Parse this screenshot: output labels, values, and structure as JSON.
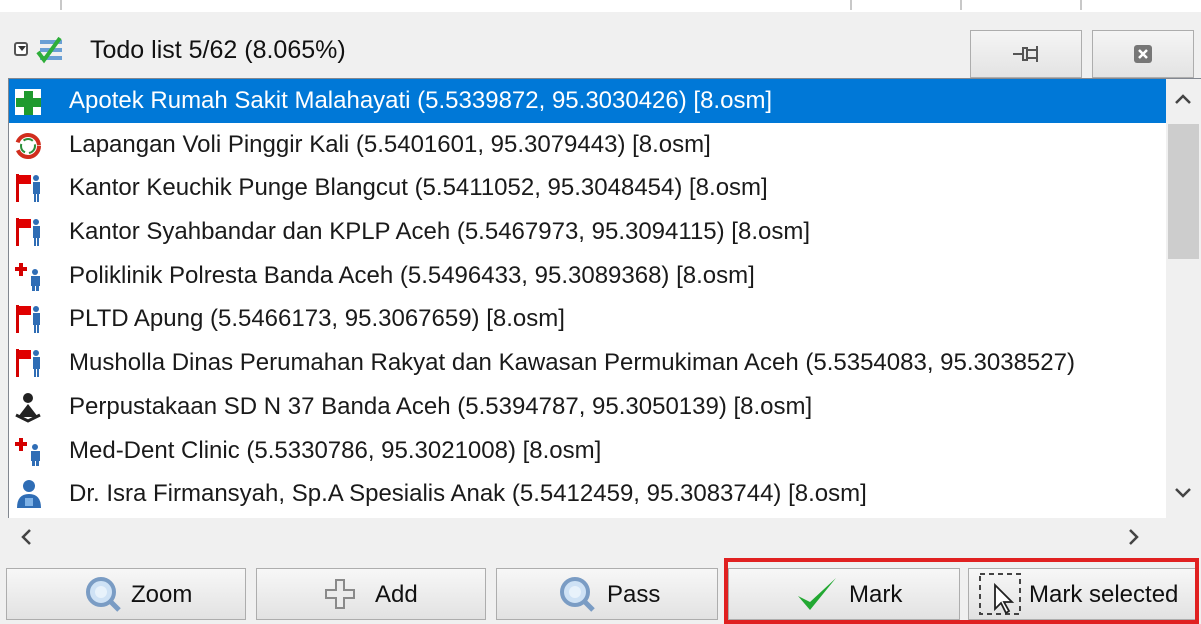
{
  "panel": {
    "title": "Todo list 5/62 (8.065%)",
    "icons": [
      "collapse-icon",
      "todo-list-icon",
      "pin-icon",
      "close-icon"
    ]
  },
  "items": [
    {
      "text": "Apotek Rumah Sakit Malahayati (5.5339872, 95.3030426) [8.osm]",
      "icon": "pharmacy-icon",
      "selected": true
    },
    {
      "text": "Lapangan Voli Pinggir Kali (5.5401601, 95.3079443) [8.osm]",
      "icon": "sports-pitch-icon",
      "selected": false
    },
    {
      "text": "Kantor Keuchik Punge Blangcut (5.5411052, 95.3048454) [8.osm]",
      "icon": "office-icon",
      "selected": false
    },
    {
      "text": "Kantor Syahbandar dan KPLP Aceh (5.5467973, 95.3094115) [8.osm]",
      "icon": "office-icon",
      "selected": false
    },
    {
      "text": "Poliklinik Polresta Banda Aceh (5.5496433, 95.3089368) [8.osm]",
      "icon": "clinic-icon",
      "selected": false
    },
    {
      "text": "PLTD Apung (5.5466173, 95.3067659) [8.osm]",
      "icon": "office-icon",
      "selected": false
    },
    {
      "text": "Musholla Dinas Perumahan Rakyat dan Kawasan Permukiman Aceh (5.5354083, 95.3038527)",
      "icon": "office-icon",
      "selected": false
    },
    {
      "text": "Perpustakaan SD N 37 Banda Aceh (5.5394787, 95.3050139) [8.osm]",
      "icon": "library-icon",
      "selected": false
    },
    {
      "text": "Med-Dent Clinic (5.5330786, 95.3021008) [8.osm]",
      "icon": "clinic-icon",
      "selected": false
    },
    {
      "text": "Dr. Isra Firmansyah, Sp.A Spesialis Anak (5.5412459, 95.3083744) [8.osm]",
      "icon": "doctor-icon",
      "selected": false
    }
  ],
  "buttons": {
    "zoom": "Zoom",
    "add": "Add",
    "pass": "Pass",
    "mark": "Mark",
    "mark_selected": "Mark selected"
  },
  "colors": {
    "selection": "#0078d7",
    "highlight_box": "#e02020"
  }
}
